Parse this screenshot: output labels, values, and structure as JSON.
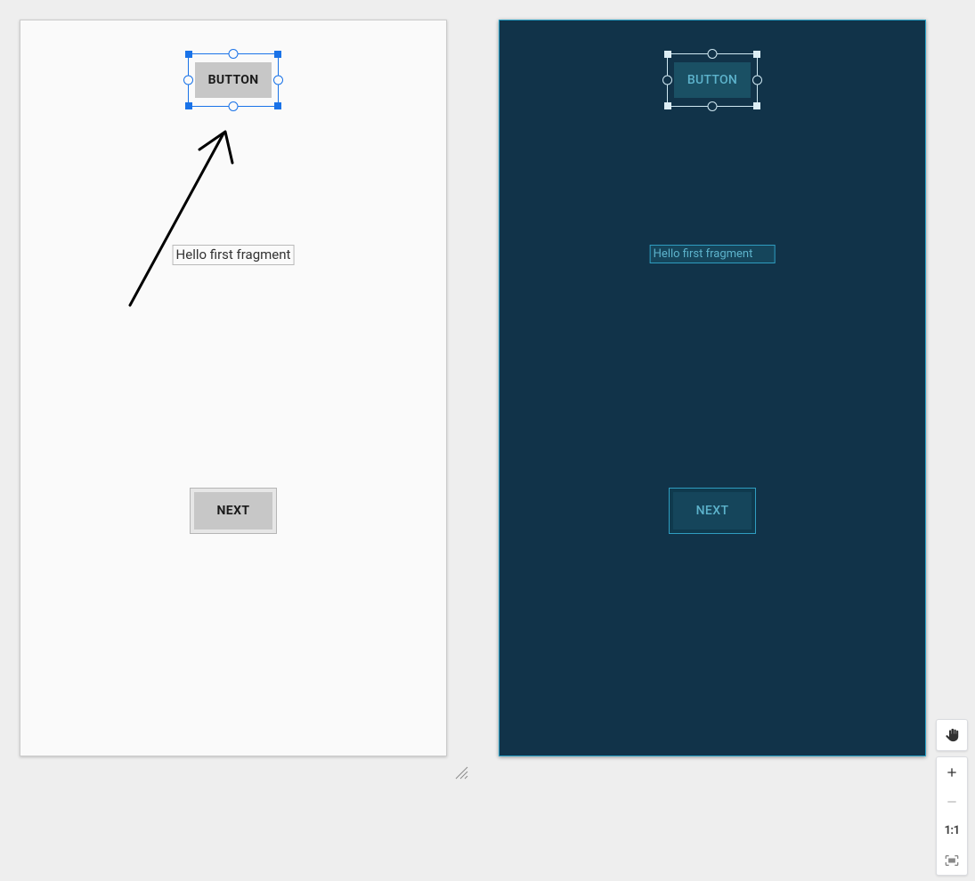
{
  "left": {
    "selected_button_label": "BUTTON",
    "fragment_text": "Hello first fragment",
    "next_label": "NEXT"
  },
  "right": {
    "selected_button_label": "BUTTON",
    "fragment_text": "Hello first fragment",
    "next_label": "NEXT"
  },
  "toolbar": {
    "one_to_one_label": "1:1"
  }
}
